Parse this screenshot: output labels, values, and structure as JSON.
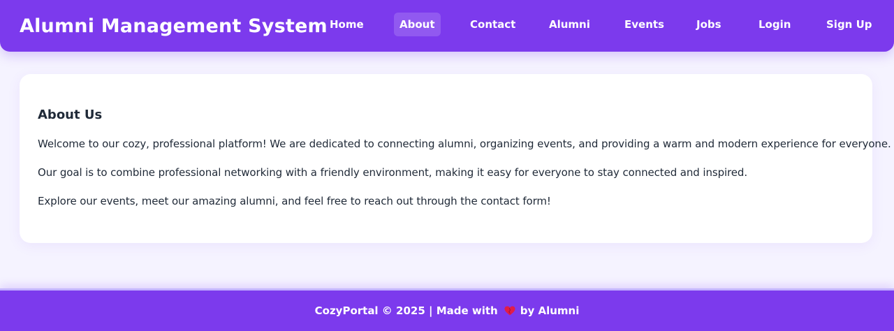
{
  "header": {
    "title": "Alumni Management System",
    "nav": [
      {
        "label": "Home",
        "active": false
      },
      {
        "label": "About",
        "active": true
      },
      {
        "label": "Contact",
        "active": false
      },
      {
        "label": "Alumni",
        "active": false
      },
      {
        "label": "Events",
        "active": false
      },
      {
        "label": "Jobs",
        "active": false
      },
      {
        "label": "Login",
        "active": false
      },
      {
        "label": "Sign Up",
        "active": false
      }
    ]
  },
  "about": {
    "heading": "About Us",
    "paragraphs": [
      "Welcome to our cozy, professional platform! We are dedicated to connecting alumni, organizing events, and providing a warm and modern experience for everyone.",
      "Our goal is to combine professional networking with a friendly environment, making it easy for everyone to stay connected and inspired.",
      "Explore our events, meet our amazing alumni, and feel free to reach out through the contact form!"
    ]
  },
  "footer": {
    "text_before": "CozyPortal © 2025 | Made with",
    "icon": "heart-icon",
    "text_after": "by Alumni"
  },
  "colors": {
    "primary": "#7c3aed",
    "background": "#f5f3ff",
    "card": "#ffffff",
    "text": "#1f2937",
    "heart": "#e11d48"
  }
}
